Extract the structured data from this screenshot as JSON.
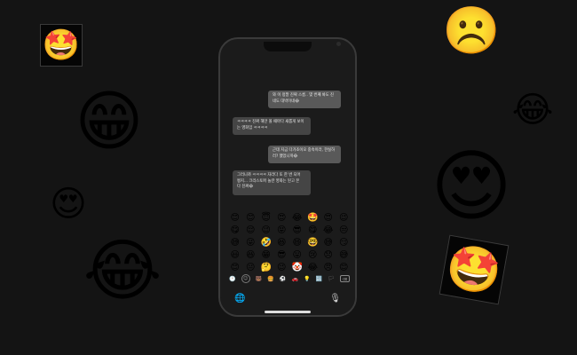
{
  "decor": {
    "star_struck_framed_top_left": "🤩",
    "frowning_top_right": "☹️",
    "grinning_big_left": "😁",
    "tears_of_joy_right": "😂",
    "heart_eyes_small_left": "😍",
    "heart_eyes_big_right": "😍",
    "rolling_laughing_bottom_left": "😂",
    "star_struck_framed_bottom_right": "🤩"
  },
  "chat": {
    "messages": [
      {
        "sender": "me",
        "text": "와 이 정말 진짜 스름.. 몇 번째 봐도 진\n네도 대박이네😂"
      },
      {
        "sender": "other",
        "text": "ㅋㅋㅋㅋ 진짜 해만 볼 때마다 새롭게 보이\n는 영화임 ㅋㅋㅋㅋ"
      },
      {
        "sender": "me",
        "text": "근데 지금 다가조이오 중속이라, 한실하\n러? 했었니까😂"
      },
      {
        "sender": "other",
        "text": "그러니까 ㅋㅋㅋㅋ 자라다 또 한 번 되어\n쩡지... 크리스토퍼 놀란 영화는 된고 본\n다 진짜😂"
      }
    ]
  },
  "keyboard": {
    "emojis": [
      "😊",
      "😊",
      "😇",
      "😍",
      "😂",
      "🤩",
      "😍",
      "😉",
      "😋",
      "😌",
      "😉",
      "😝",
      "😎",
      "😋",
      "😂",
      "😒",
      "😅",
      "😜",
      "🤣",
      "😆",
      "😄",
      "🤓",
      "😅",
      "😏",
      "😃",
      "😆",
      "😁",
      "😎",
      "😛",
      "😢",
      "😞",
      "😅",
      "😊",
      "😐",
      "🤔",
      "😉",
      "🤡",
      "😂",
      "😠",
      "😊"
    ],
    "categories": [
      "🕐",
      "☺",
      "🐻",
      "🍔",
      "⚽",
      "🚗",
      "💡",
      "🔣",
      "🏳"
    ],
    "delete_label": "⌫",
    "globe_icon": "🌐",
    "mic_icon": "🎙"
  }
}
